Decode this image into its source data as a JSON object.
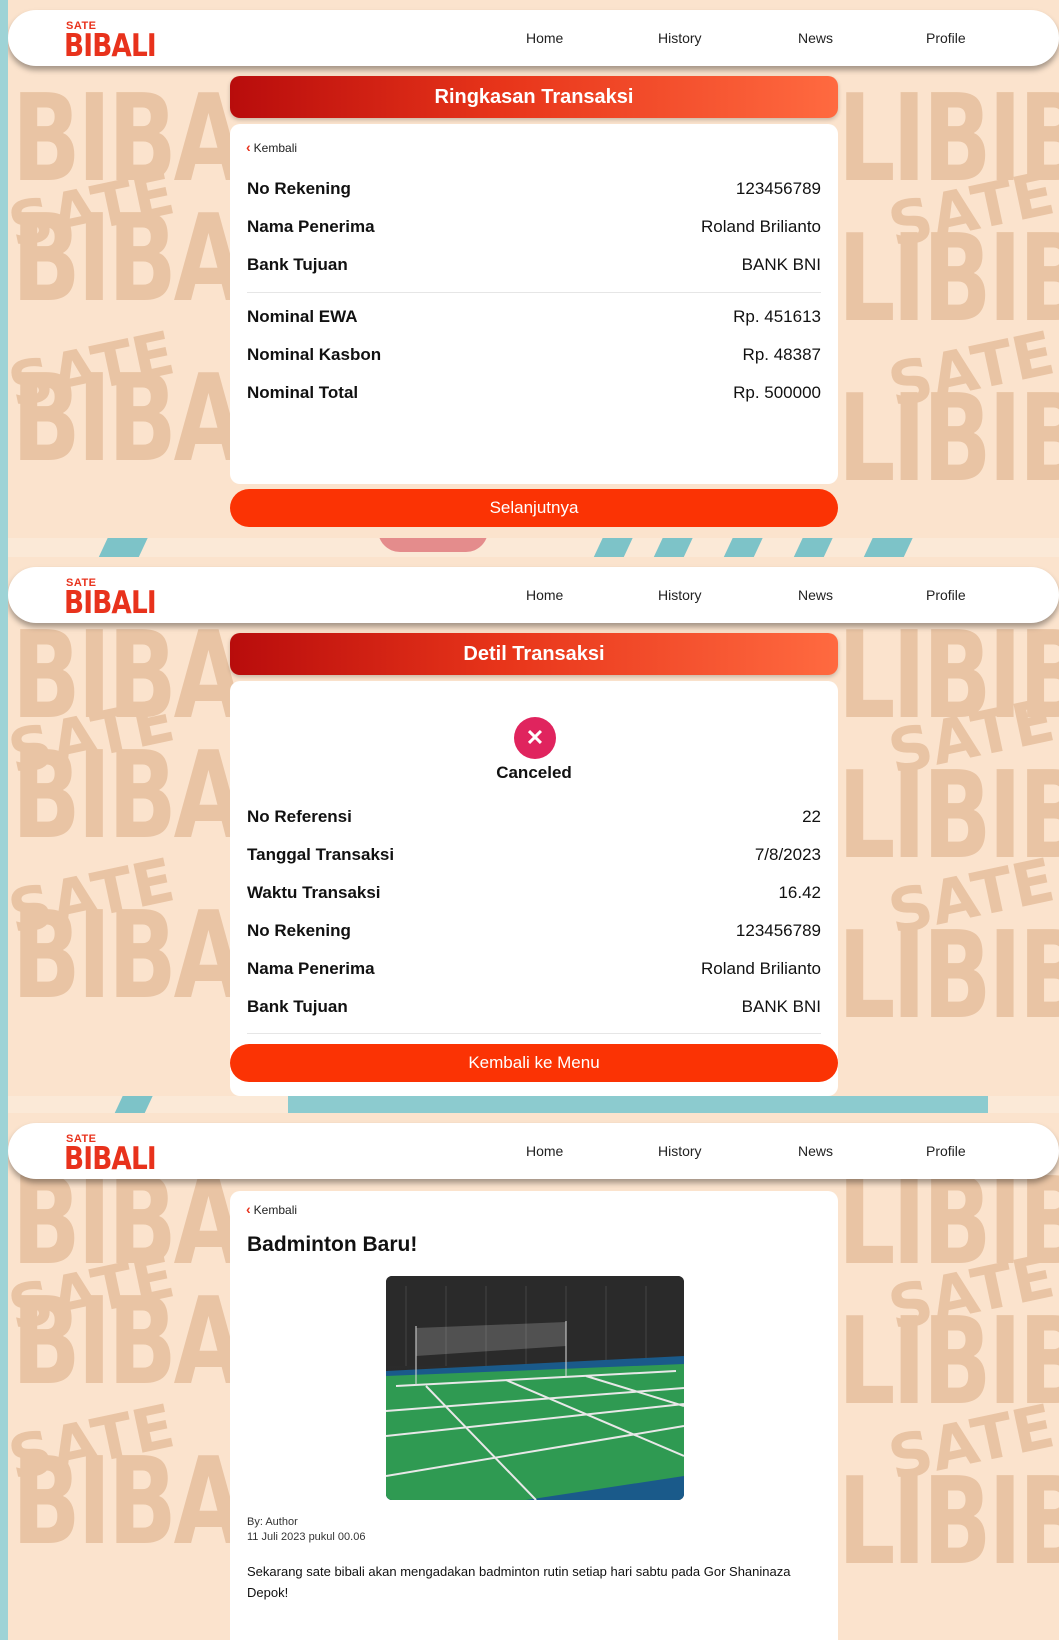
{
  "brand": {
    "small": "SATE",
    "name": "BIBALI"
  },
  "nav": {
    "home": "Home",
    "history": "History",
    "news": "News",
    "profile": "Profile"
  },
  "watermark": {
    "big": "BIBA",
    "big_right": "LIBIB",
    "small": "SATE"
  },
  "summary": {
    "title": "Ringkasan Transaksi",
    "back": "Kembali",
    "rows": [
      {
        "label": "No Rekening",
        "value": "123456789"
      },
      {
        "label": "Nama Penerima",
        "value": "Roland Brilianto"
      },
      {
        "label": "Bank Tujuan",
        "value": "BANK BNI"
      },
      {
        "label": "Nominal EWA",
        "value": "Rp. 451613"
      },
      {
        "label": "Nominal Kasbon",
        "value": "Rp. 48387"
      },
      {
        "label": "Nominal Total",
        "value": "Rp. 500000"
      }
    ],
    "button": "Selanjutnya"
  },
  "detail": {
    "title": "Detil Transaksi",
    "status_icon": "x-icon",
    "status": "Canceled",
    "status_color": "#e0245e",
    "rows": [
      {
        "label": "No Referensi",
        "value": "22"
      },
      {
        "label": "Tanggal Transaksi",
        "value": "7/8/2023"
      },
      {
        "label": "Waktu Transaksi",
        "value": "16.42"
      },
      {
        "label": "No Rekening",
        "value": "123456789"
      },
      {
        "label": "Nama Penerima",
        "value": "Roland Brilianto"
      },
      {
        "label": "Bank Tujuan",
        "value": "BANK BNI"
      }
    ],
    "button": "Kembali ke Menu"
  },
  "news": {
    "back": "Kembali",
    "title": "Badminton Baru!",
    "author": "By: Author",
    "date": "11 Juli 2023 pukul 00.06",
    "body": "Sekarang sate bibali akan mengadakan badminton rutin setiap hari sabtu pada Gor Shaninaza Depok!"
  },
  "colors": {
    "accent": "#fb3304",
    "brand": "#e8321c",
    "background": "#fbe3cd"
  }
}
